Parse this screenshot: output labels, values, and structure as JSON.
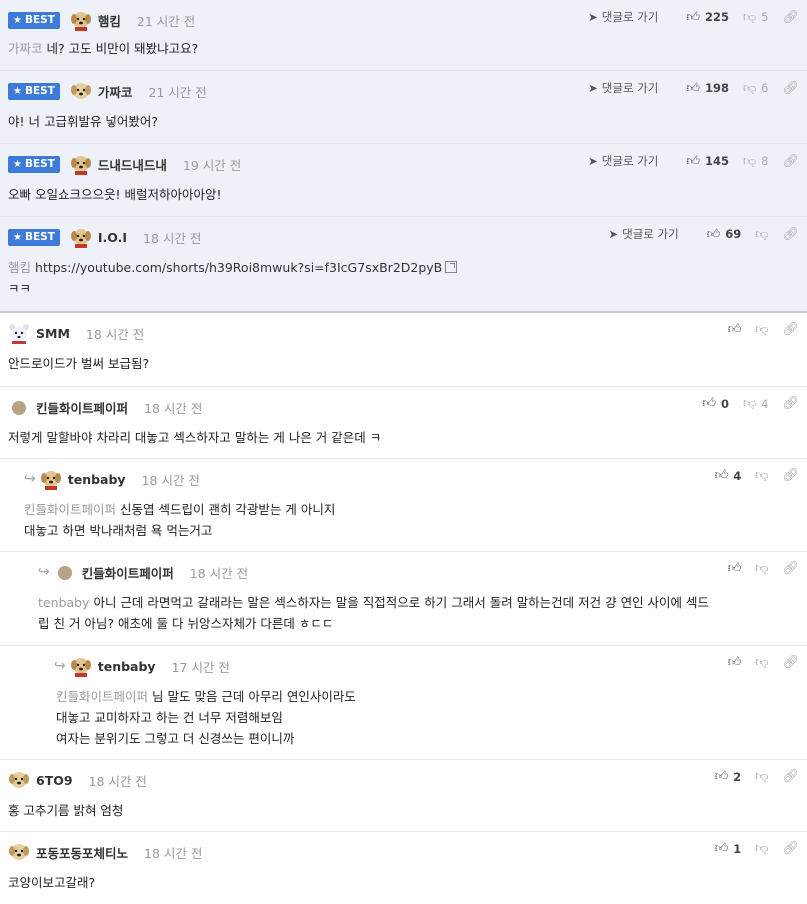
{
  "ui": {
    "goto_label": "댓글로 가기",
    "best_label": "BEST"
  },
  "comments": [
    {
      "nick": "햄킴",
      "time": "21 시간 전",
      "to": "가짜코",
      "lines": [
        "네? 고도 비만이 돼봤냐고요?"
      ],
      "up": "225",
      "down": "5"
    },
    {
      "nick": "가짜코",
      "time": "21 시간 전",
      "to": "",
      "lines": [
        "야! 너 고급휘발유 넣어봤어?"
      ],
      "up": "198",
      "down": "6"
    },
    {
      "nick": "드내드내드내",
      "time": "19 시간 전",
      "to": "",
      "lines": [
        "오빠 오일쇼크으으읏! 배럴저하아아아앙!"
      ],
      "up": "145",
      "down": "8"
    },
    {
      "nick": "I.O.I",
      "time": "18 시간 전",
      "to": "햄킴",
      "lines": [
        "https://youtube.com/shorts/h39Roi8mwuk?si=f3IcG7sxBr2D2pyB",
        "ㅋㅋ"
      ],
      "up": "69",
      "down": ""
    },
    {
      "nick": "SMM",
      "time": "18 시간 전",
      "to": "",
      "lines": [
        "안드로이드가 벌써 보급됨?"
      ],
      "up": "",
      "down": ""
    },
    {
      "nick": "킨들화이트페이퍼",
      "time": "18 시간 전",
      "to": "",
      "lines": [
        "저렇게 말할바야 차라리 대놓고 섹스하자고 말하는 게 나은 거 같은데 ㅋ"
      ],
      "up": "0",
      "down": "4"
    },
    {
      "nick": "tenbaby",
      "time": "18 시간 전",
      "to": "킨들화이트페이퍼",
      "lines": [
        "신동엽 섹드립이 괜히 각광받는 게 아니지",
        "대놓고 하면 박나래처럼 욕 먹는거고"
      ],
      "up": "4",
      "down": ""
    },
    {
      "nick": "킨들화이트페이퍼",
      "time": "18 시간 전",
      "to": "tenbaby",
      "lines": [
        "아니 근데 라면먹고 갈래라는 말은 섹스하자는 말을 직접적으로 하기 그래서 돌려 말하는건데 저건 걍 연인 사이에 섹드",
        "립 친 거 아님? 애초에 둘 다 뉘앙스자체가 다른데 ㅎㄷㄷ"
      ],
      "up": "",
      "down": ""
    },
    {
      "nick": "tenbaby",
      "time": "17 시간 전",
      "to": "킨들화이트페이퍼",
      "lines": [
        "님 말도 맞음 근데 아무리 연인사이라도",
        "대놓고 교미하자고 하는 건 너무 저렴해보임",
        "여자는 분위기도 그렇고 더 신경쓰는 편이니까"
      ],
      "up": "",
      "down": ""
    },
    {
      "nick": "6TO9",
      "time": "18 시간 전",
      "to": "",
      "lines": [
        "홍 고추기름 밝혀 엄청"
      ],
      "up": "2",
      "down": ""
    },
    {
      "nick": "포동포동포체티노",
      "time": "18 시간 전",
      "to": "",
      "lines": [
        "코양이보고갈래?"
      ],
      "up": "1",
      "down": ""
    }
  ]
}
